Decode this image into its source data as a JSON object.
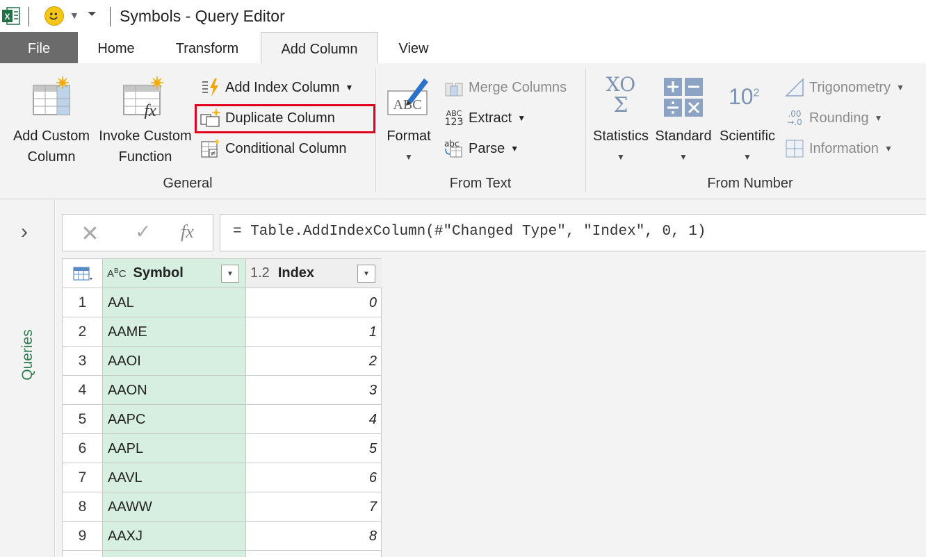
{
  "window": {
    "title": "Symbols - Query Editor"
  },
  "tabs": [
    {
      "label": "File"
    },
    {
      "label": "Home"
    },
    {
      "label": "Transform"
    },
    {
      "label": "Add Column"
    },
    {
      "label": "View"
    }
  ],
  "active_tab": "Add Column",
  "ribbon": {
    "general": {
      "group_label": "General",
      "add_custom_column": [
        "Add Custom",
        "Column"
      ],
      "invoke_custom_function": [
        "Invoke Custom",
        "Function"
      ],
      "add_index_column": "Add Index Column",
      "duplicate_column": "Duplicate Column",
      "conditional_column": "Conditional Column"
    },
    "from_text": {
      "group_label": "From Text",
      "format": "Format",
      "merge_columns": "Merge Columns",
      "extract": "Extract",
      "parse": "Parse",
      "extract_icon_text": [
        "ABC",
        "123"
      ],
      "parse_icon_text": "abc",
      "format_icon_text": "ABC"
    },
    "from_number": {
      "group_label": "From Number",
      "statistics": "Statistics",
      "standard": "Standard",
      "scientific": "Scientific",
      "scientific_icon_text": "10",
      "scientific_icon_sup": "2",
      "statistics_icon_text": [
        "XO",
        "Σ"
      ],
      "trigonometry": "Trigonometry",
      "rounding": "Rounding",
      "information": "Information"
    }
  },
  "highlight": {
    "target": "Duplicate Column",
    "color": "#e0001b"
  },
  "formula_bar": {
    "text": "= Table.AddIndexColumn(#\"Changed Type\", \"Index\", 0, 1)",
    "fx_label": "fx"
  },
  "queries_pane": {
    "label": "Queries"
  },
  "table": {
    "columns": [
      {
        "type_icon": "ABC",
        "name": "Symbol"
      },
      {
        "type_icon": "1.2",
        "name": "Index"
      }
    ],
    "rows": [
      {
        "n": "1",
        "symbol": "AAL",
        "index": "0"
      },
      {
        "n": "2",
        "symbol": "AAME",
        "index": "1"
      },
      {
        "n": "3",
        "symbol": "AAOI",
        "index": "2"
      },
      {
        "n": "4",
        "symbol": "AAON",
        "index": "3"
      },
      {
        "n": "5",
        "symbol": "AAPC",
        "index": "4"
      },
      {
        "n": "6",
        "symbol": "AAPL",
        "index": "5"
      },
      {
        "n": "7",
        "symbol": "AAVL",
        "index": "6"
      },
      {
        "n": "8",
        "symbol": "AAWW",
        "index": "7"
      },
      {
        "n": "9",
        "symbol": "AAXJ",
        "index": "8"
      }
    ]
  },
  "colors": {
    "accent_green": "#2e7d4f",
    "symbol_column_bg": "#d7efe1",
    "file_tab_bg": "#6b6b6b"
  }
}
